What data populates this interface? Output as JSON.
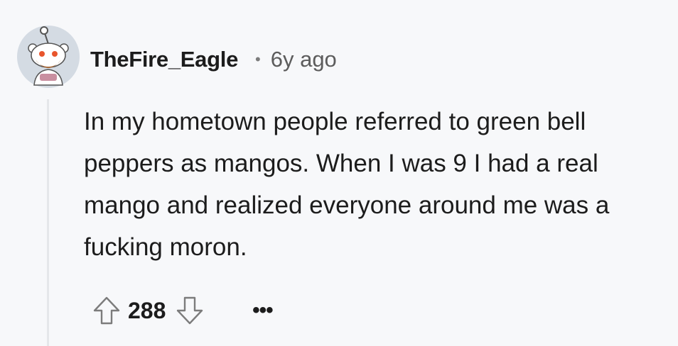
{
  "comment": {
    "username": "TheFire_Eagle",
    "separator": "•",
    "timestamp": "6y ago",
    "body": "In my hometown people referred to green bell peppers as mangos. When I was 9 I had a real mango and realized everyone around me was a fucking moron.",
    "score": "288",
    "more_label": "•••"
  },
  "icons": {
    "avatar": "snoo-avatar",
    "upvote": "arrow-up-icon",
    "downvote": "arrow-down-icon"
  },
  "colors": {
    "background": "#f7f8fa",
    "text": "#1c1c1c",
    "muted": "#5c5c5c",
    "thread_line": "#e5e7ea",
    "avatar_bg": "#d4dbe3"
  }
}
